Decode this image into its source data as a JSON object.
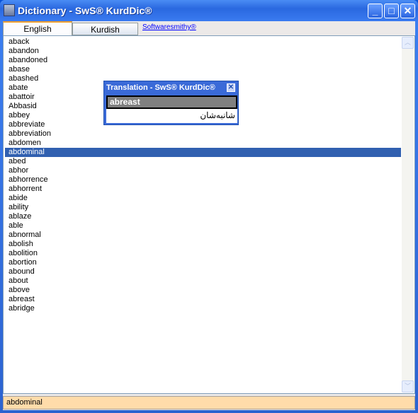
{
  "window": {
    "title": "Dictionary - SwS® KurdDic®",
    "minimize": "_",
    "maximize": "□",
    "close": "✕"
  },
  "tabs": [
    {
      "label": "English"
    },
    {
      "label": "Kurdish"
    }
  ],
  "link": "Softwaresmithy®",
  "words": [
    "aback",
    "abandon",
    "abandoned",
    "abase",
    "abashed",
    "abate",
    "abattoir",
    "Abbasid",
    "abbey",
    "abbreviate",
    "abbreviation",
    "abdomen",
    "abdominal",
    "abed",
    "abhor",
    "abhorrence",
    "abhorrent",
    "abide",
    "ability",
    "ablaze",
    "able",
    "abnormal",
    "abolish",
    "abolition",
    "abortion",
    "abound",
    "about",
    "above",
    "abreast",
    "abridge"
  ],
  "selected": "abdominal",
  "scroll": {
    "up": "︿",
    "down": "﹀"
  },
  "status": "abdominal",
  "popup": {
    "title": "Translation - SwS® KurdDic®",
    "close": "✕",
    "word": "abreast",
    "translation": "شانبەشان"
  }
}
